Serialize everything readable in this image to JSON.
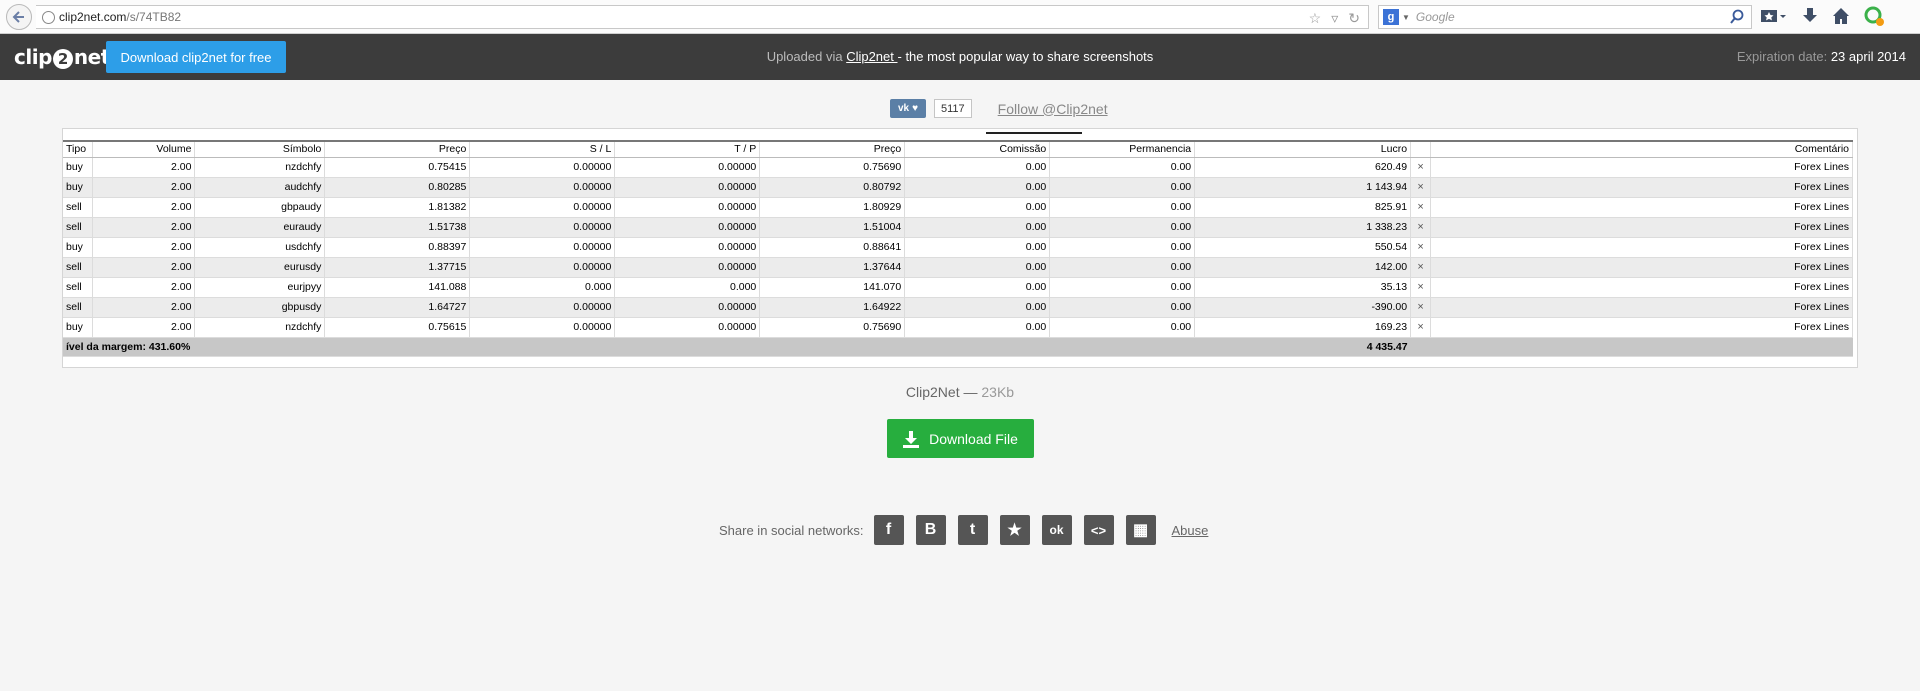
{
  "browser": {
    "url_host": "clip2net.com",
    "url_path": "/s/74TB82",
    "search_placeholder": "Google",
    "search_engine_letter": "g"
  },
  "header": {
    "logo_left": "clip",
    "logo_mid": "2",
    "logo_right": "net",
    "download_button": "Download clip2net for free",
    "uploaded_prefix": "Uploaded via ",
    "uploaded_link": "Clip2net ",
    "uploaded_suffix": "- the most popular way to share screenshots",
    "expiration_label": "Expiration date: ",
    "expiration_date": "23 april 2014"
  },
  "social_top": {
    "vk_label": "vk",
    "vk_count": "5117",
    "follow": "Follow @Clip2net"
  },
  "table": {
    "headers": [
      "Tipo",
      "Volume",
      "Símbolo",
      "Preço",
      "S / L",
      "T / P",
      "Preço",
      "Comissão",
      "Permanencia",
      "Lucro",
      "",
      "Comentário"
    ],
    "rows": [
      [
        "buy",
        "2.00",
        "nzdchfy",
        "0.75415",
        "0.00000",
        "0.00000",
        "0.75690",
        "0.00",
        "0.00",
        "620.49",
        "×",
        "Forex Lines"
      ],
      [
        "buy",
        "2.00",
        "audchfy",
        "0.80285",
        "0.00000",
        "0.00000",
        "0.80792",
        "0.00",
        "0.00",
        "1 143.94",
        "×",
        "Forex Lines"
      ],
      [
        "sell",
        "2.00",
        "gbpaudy",
        "1.81382",
        "0.00000",
        "0.00000",
        "1.80929",
        "0.00",
        "0.00",
        "825.91",
        "×",
        "Forex Lines"
      ],
      [
        "sell",
        "2.00",
        "euraudy",
        "1.51738",
        "0.00000",
        "0.00000",
        "1.51004",
        "0.00",
        "0.00",
        "1 338.23",
        "×",
        "Forex Lines"
      ],
      [
        "buy",
        "2.00",
        "usdchfy",
        "0.88397",
        "0.00000",
        "0.00000",
        "0.88641",
        "0.00",
        "0.00",
        "550.54",
        "×",
        "Forex Lines"
      ],
      [
        "sell",
        "2.00",
        "eurusdy",
        "1.37715",
        "0.00000",
        "0.00000",
        "1.37644",
        "0.00",
        "0.00",
        "142.00",
        "×",
        "Forex Lines"
      ],
      [
        "sell",
        "2.00",
        "eurjpyy",
        "141.088",
        "0.000",
        "0.000",
        "141.070",
        "0.00",
        "0.00",
        "35.13",
        "×",
        "Forex Lines"
      ],
      [
        "sell",
        "2.00",
        "gbpusdy",
        "1.64727",
        "0.00000",
        "0.00000",
        "1.64922",
        "0.00",
        "0.00",
        "-390.00",
        "×",
        "Forex Lines"
      ],
      [
        "buy",
        "2.00",
        "nzdchfy",
        "0.75615",
        "0.00000",
        "0.00000",
        "0.75690",
        "0.00",
        "0.00",
        "169.23",
        "×",
        "Forex Lines"
      ]
    ],
    "total_label": "ível da margem: 431.60%",
    "total_value": "4 435.47"
  },
  "file": {
    "name": "Clip2Net",
    "separator": " — ",
    "size": "23Kb",
    "download_button": "Download File"
  },
  "share": {
    "label": "Share in social networks:",
    "icons": [
      "f",
      "B",
      "t",
      "★",
      "ok",
      "<>",
      "▦"
    ],
    "abuse": "Abuse"
  }
}
